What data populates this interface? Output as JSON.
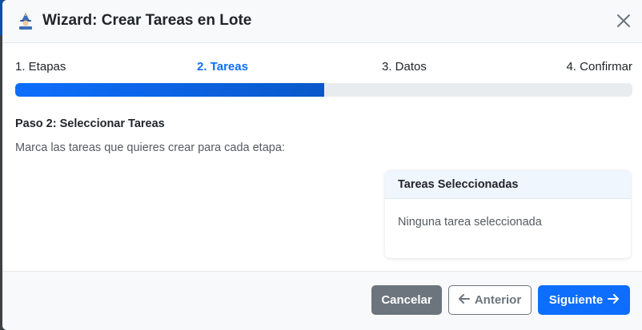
{
  "modal": {
    "title": "Wizard: Crear Tareas en Lote",
    "title_icon": "wizard-icon",
    "close_icon": "close-icon"
  },
  "steps": [
    {
      "label": "1. Etapas"
    },
    {
      "label": "2. Tareas"
    },
    {
      "label": "3. Datos"
    },
    {
      "label": "4. Confirmar"
    }
  ],
  "progress": {
    "value_fraction": 0.5
  },
  "content": {
    "heading": "Paso 2: Seleccionar Tareas",
    "description": "Marca las tareas que quieres crear para cada etapa:"
  },
  "selected_panel": {
    "header": "Tareas Seleccionadas",
    "empty_text": "Ninguna tarea seleccionada"
  },
  "footer": {
    "cancel_label": "Cancelar",
    "prev_label": "Anterior",
    "prev_icon": "arrow-left-icon",
    "next_label": "Siguiente",
    "next_icon": "arrow-right-icon"
  },
  "colors": {
    "primary": "#0d6efd",
    "secondary": "#6c757d"
  }
}
